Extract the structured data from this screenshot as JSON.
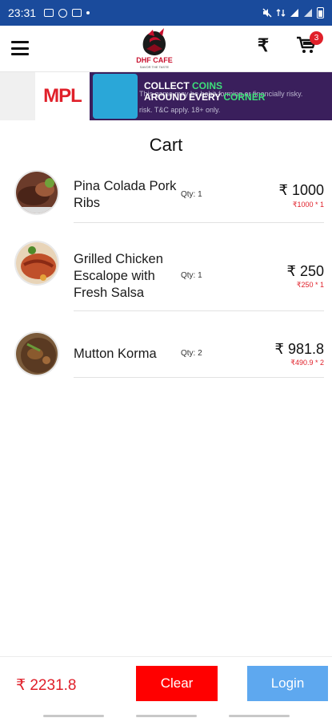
{
  "status_bar": {
    "time": "23:31"
  },
  "header": {
    "logo_text": "DHF CAFE",
    "logo_subtitle": "SAVOR THE TASTE",
    "rupee_symbol": "₹",
    "cart_count": "3"
  },
  "ad": {
    "brand": "MPL",
    "headline_1": "COLLECT",
    "headline_1_hl": "COINS",
    "headline_2": "AROUND EVERY",
    "headline_2_hl": "CORNER",
    "disclaimer_1": "This game may be habit-forming or financially risky.",
    "disclaimer_2": "risk. T&C apply. 18+ only."
  },
  "cart": {
    "title": "Cart",
    "items": [
      {
        "name": "Pina Colada Pork Ribs",
        "qty": "Qty: 1",
        "price": "₹ 1000",
        "unit": "₹1000 * 1"
      },
      {
        "name": "Grilled Chicken Escalope with Fresh Salsa",
        "qty": "Qty: 1",
        "price": "₹ 250",
        "unit": "₹250 * 1"
      },
      {
        "name": "Mutton Korma",
        "qty": "Qty: 2",
        "price": "₹ 981.8",
        "unit": "₹490.9 * 2"
      }
    ]
  },
  "footer": {
    "total": "₹ 2231.8",
    "clear_label": "Clear",
    "login_label": "Login"
  },
  "colors": {
    "status_bar": "#1a4b9c",
    "accent_red": "#e0202a",
    "clear_button": "#ff0000",
    "login_button": "#5ea8ef"
  }
}
